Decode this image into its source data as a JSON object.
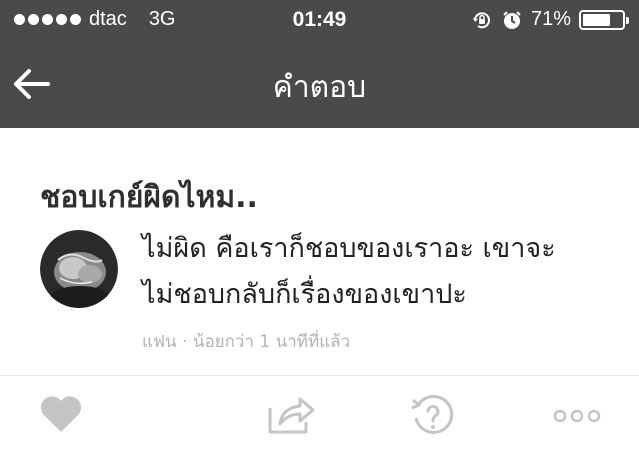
{
  "status_bar": {
    "carrier": "dtac",
    "network": "3G",
    "time": "01:49",
    "battery": "71%",
    "battery_level": 0.71,
    "icons": [
      "signal-dots-icon",
      "rotation-lock-icon",
      "alarm-icon",
      "battery-icon"
    ]
  },
  "nav": {
    "title": "คำตอบ",
    "back_icon": "back-arrow-icon"
  },
  "post": {
    "question": "ชอบเกย์ผิดไหม..",
    "answer_line1": "ไม่ผิด คือเราก็ชอบของเราอะ เขาจะ",
    "answer_line2": "ไม่ชอบกลับก็เรื่องของเขาปะ",
    "meta": "แฟน · น้อยกว่า 1 นาทีที่แล้ว"
  },
  "actions": [
    "heart-icon",
    "share-icon",
    "question-icon",
    "more-icon"
  ],
  "colors": {
    "bar_bg": "#4a4a4c",
    "icon_gray": "#c4c4c4",
    "meta_gray": "#b3b3b3"
  }
}
